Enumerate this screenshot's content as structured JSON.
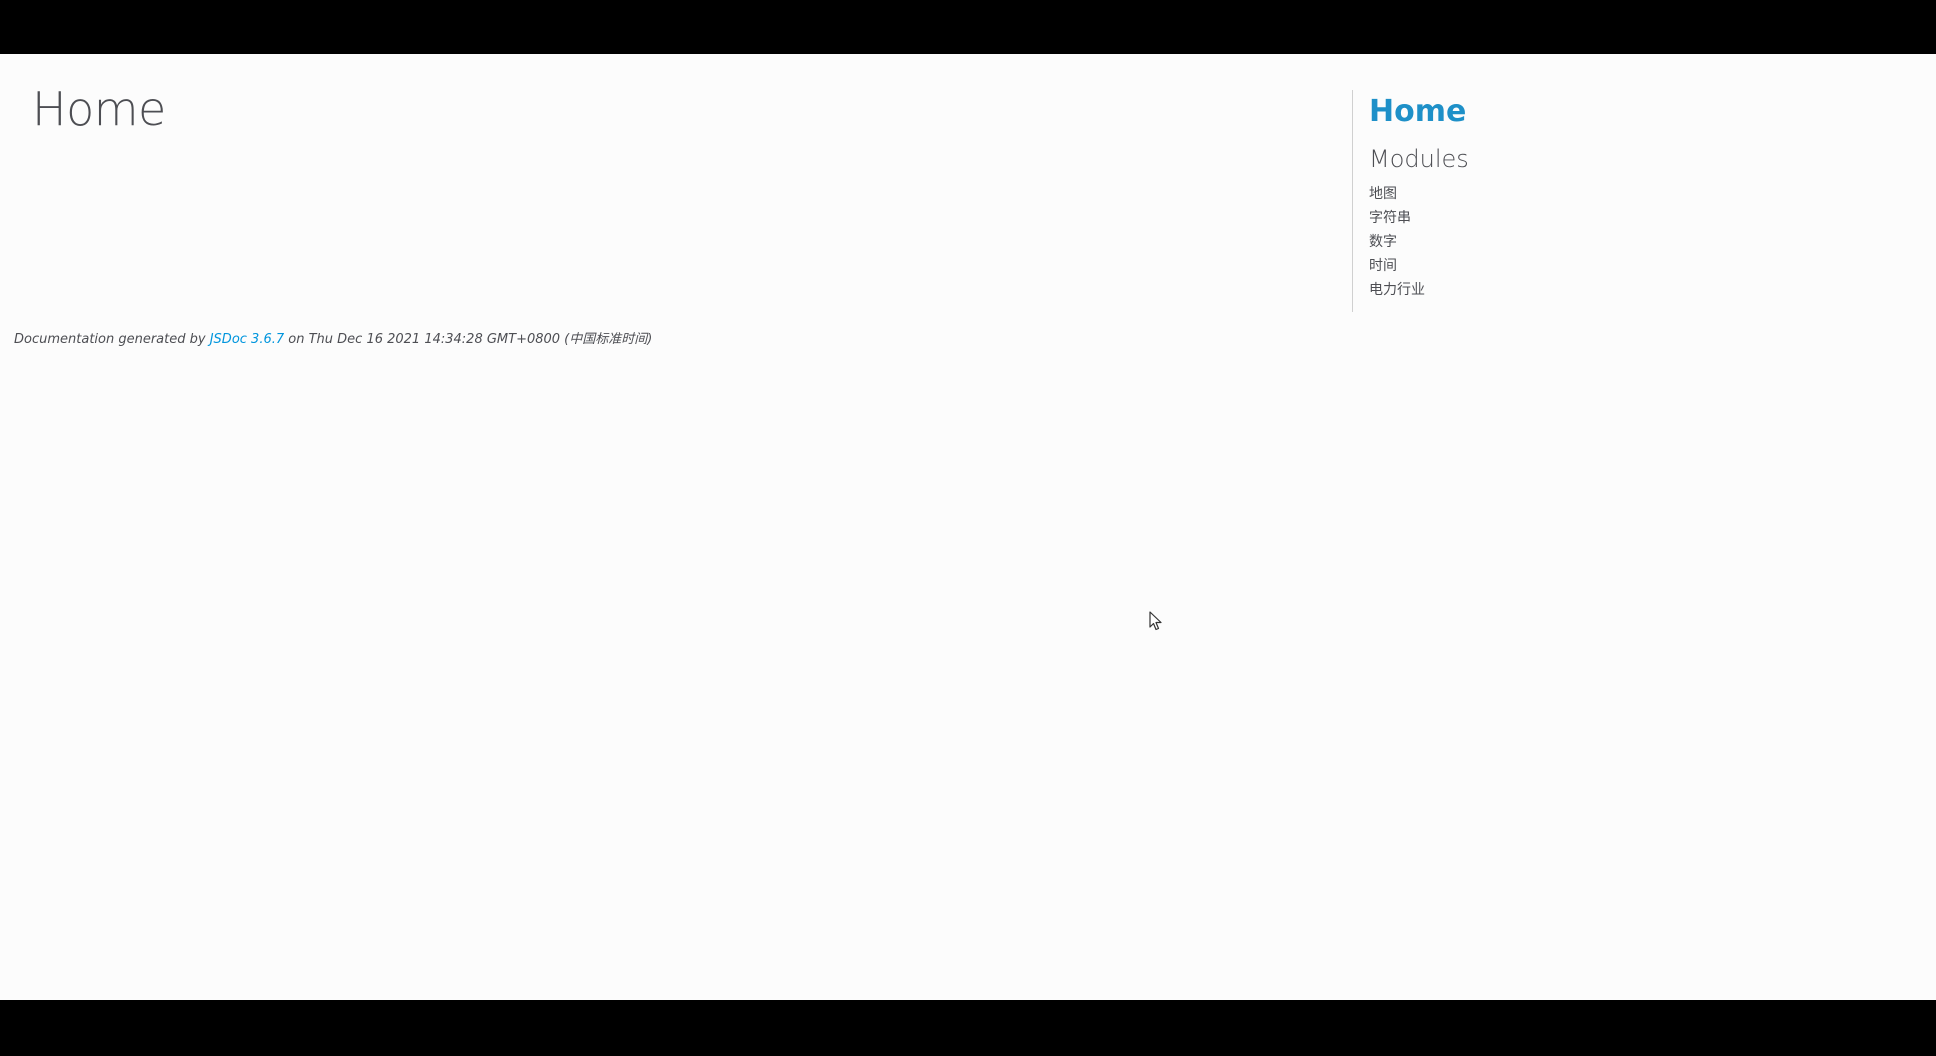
{
  "page": {
    "title": "Home"
  },
  "footer": {
    "prefix": "Documentation generated by ",
    "link_text": "JSDoc 3.6.7",
    "suffix": " on Thu Dec 16 2021 14:34:28 GMT+0800 (中国标准时间)"
  },
  "nav": {
    "home_label": "Home",
    "modules_heading": "Modules",
    "modules": [
      {
        "label": "地图"
      },
      {
        "label": "字符串"
      },
      {
        "label": "数字"
      },
      {
        "label": "时间"
      },
      {
        "label": "电力行业"
      }
    ]
  },
  "toolbar": {
    "buttons": [
      {
        "icon": "pause-icon"
      },
      {
        "icon": "pointer-icon"
      },
      {
        "icon": "pencil-icon"
      },
      {
        "icon": "camera-icon"
      },
      {
        "icon": "microphone-icon"
      },
      {
        "icon": "speaker-icon"
      },
      {
        "icon": "gear-icon"
      }
    ]
  },
  "colors": {
    "accent": "#1e90c8",
    "link": "#0095dd",
    "text": "#4d4e53",
    "background": "#fcfcfc",
    "toolbar_button_fill": "#cfe3f7"
  }
}
